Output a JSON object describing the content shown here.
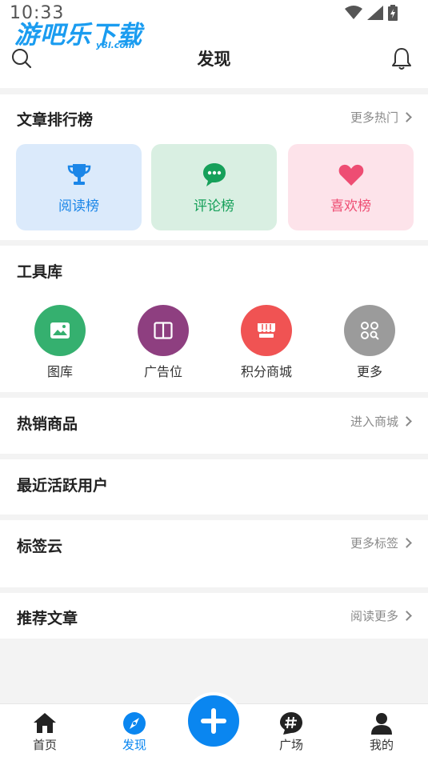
{
  "status_bar": {
    "time": "10:33"
  },
  "watermark": {
    "text": "游吧乐下载",
    "sub": "y8l.com"
  },
  "header": {
    "title": "发现"
  },
  "ranking": {
    "title": "文章排行榜",
    "more": "更多热门",
    "cards": [
      {
        "label": "阅读榜",
        "icon": "trophy-icon",
        "color": "#1b86e8",
        "bg": "#dbeafb"
      },
      {
        "label": "评论榜",
        "icon": "comment-icon",
        "color": "#16a05a",
        "bg": "#d9efe2"
      },
      {
        "label": "喜欢榜",
        "icon": "heart-icon",
        "color": "#ee4d73",
        "bg": "#fde3ea"
      }
    ]
  },
  "tools": {
    "title": "工具库",
    "items": [
      {
        "label": "图库",
        "icon": "gallery-icon",
        "color": "#35b06f"
      },
      {
        "label": "广告位",
        "icon": "ad-book-icon",
        "color": "#8e3f80"
      },
      {
        "label": "积分商城",
        "icon": "shop-icon",
        "color": "#f05353"
      },
      {
        "label": "更多",
        "icon": "grid-more-icon",
        "color": "#9b9b9b"
      }
    ]
  },
  "hot_products": {
    "title": "热销商品",
    "more": "进入商城"
  },
  "active_users": {
    "title": "最近活跃用户"
  },
  "tag_cloud": {
    "title": "标签云",
    "more": "更多标签"
  },
  "recommended": {
    "title": "推荐文章",
    "more": "阅读更多"
  },
  "bottom_nav": {
    "items": [
      {
        "label": "首页",
        "icon": "home-icon"
      },
      {
        "label": "发现",
        "icon": "compass-icon",
        "active": true
      },
      {
        "label": "广场",
        "icon": "hashtag-icon"
      },
      {
        "label": "我的",
        "icon": "user-icon"
      }
    ],
    "fab_icon": "plus-icon",
    "active_color": "#0a86f0"
  }
}
